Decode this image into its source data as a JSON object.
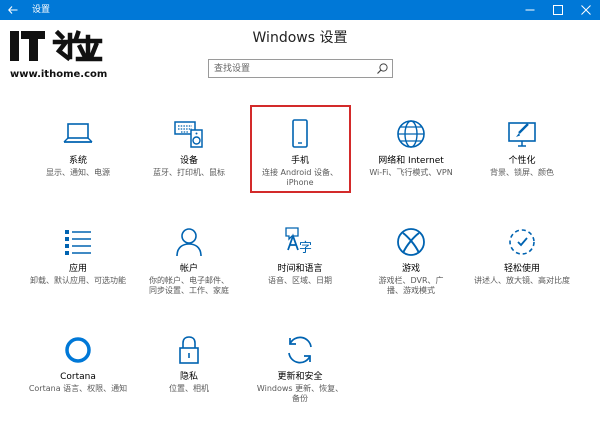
{
  "window": {
    "title": "设置",
    "accent": "#0078d7",
    "back_icon": "back-arrow-icon",
    "minimize_icon": "minimize-icon",
    "maximize_icon": "maximize-icon",
    "close_icon": "close-icon"
  },
  "watermark": {
    "brand": "IT之家",
    "url": "www.ithome.com"
  },
  "header": {
    "title": "Windows 设置"
  },
  "search": {
    "placeholder": "查找设置",
    "icon": "search-icon"
  },
  "highlight_color": "#d32a2a",
  "tiles": [
    {
      "label": "系统",
      "desc": "显示、通知、电源",
      "icon": "laptop-icon"
    },
    {
      "label": "设备",
      "desc": "蓝牙、打印机、鼠标",
      "icon": "keyboard-speaker-icon"
    },
    {
      "label": "手机",
      "desc": "连接 Android 设备、iPhone",
      "icon": "phone-icon"
    },
    {
      "label": "网络和 Internet",
      "desc": "Wi-Fi、飞行模式、VPN",
      "icon": "globe-icon"
    },
    {
      "label": "个性化",
      "desc": "背景、锁屏、颜色",
      "icon": "paint-monitor-icon"
    },
    {
      "label": "应用",
      "desc": "卸载、默认应用、可选功能",
      "icon": "apps-list-icon"
    },
    {
      "label": "帐户",
      "desc": "你的帐户、电子邮件、同步设置、工作、家庭",
      "icon": "person-icon"
    },
    {
      "label": "时间和语言",
      "desc": "语音、区域、日期",
      "icon": "time-language-icon"
    },
    {
      "label": "游戏",
      "desc": "游戏栏、DVR、广播、游戏模式",
      "icon": "xbox-icon"
    },
    {
      "label": "轻松使用",
      "desc": "讲述人、放大镜、高对比度",
      "icon": "ease-of-access-icon"
    },
    {
      "label": "Cortana",
      "desc": "Cortana 语言、权限、通知",
      "icon": "cortana-icon"
    },
    {
      "label": "隐私",
      "desc": "位置、相机",
      "icon": "lock-icon"
    },
    {
      "label": "更新和安全",
      "desc": "Windows 更新、恢复、备份",
      "icon": "update-icon"
    }
  ]
}
